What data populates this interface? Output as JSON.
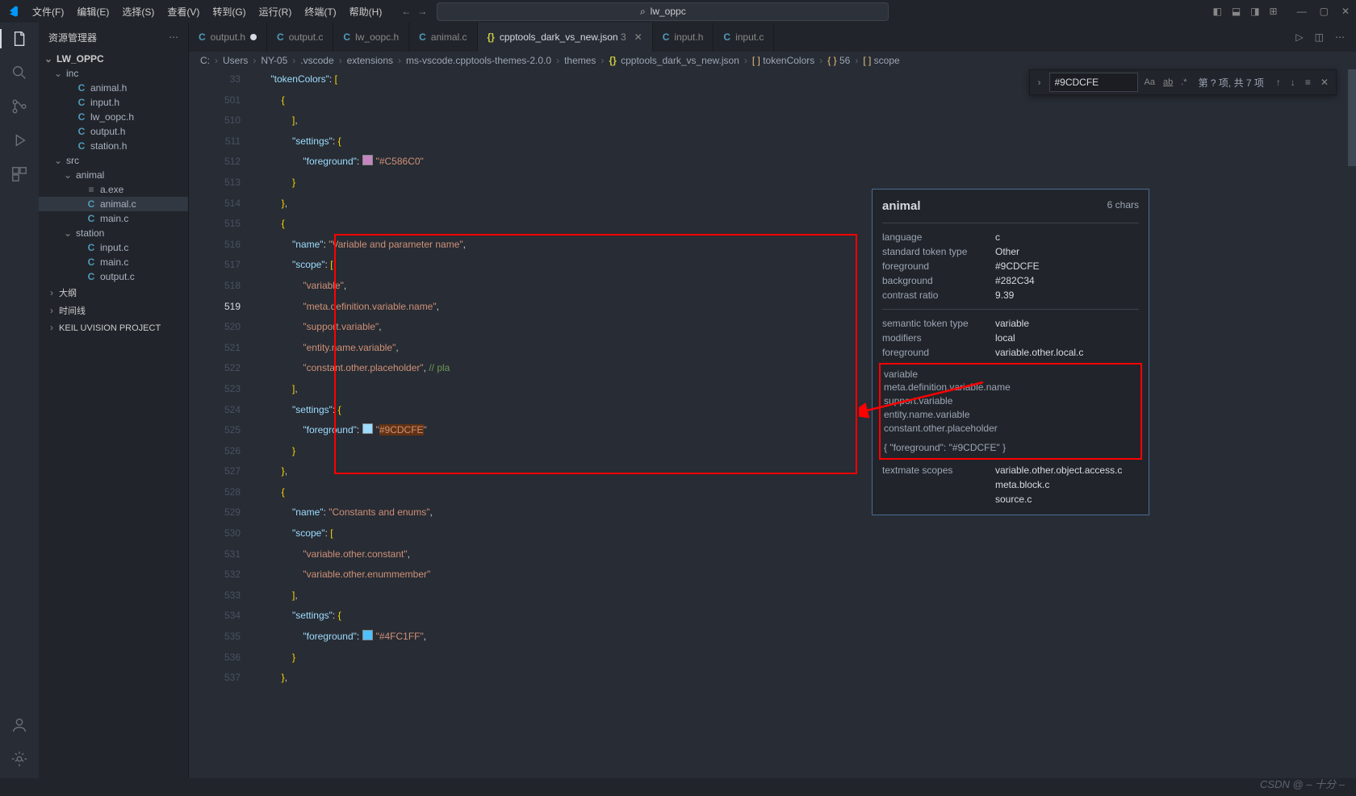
{
  "title": "lw_oppc",
  "menu": [
    "文件(F)",
    "编辑(E)",
    "选择(S)",
    "查看(V)",
    "转到(G)",
    "运行(R)",
    "终端(T)",
    "帮助(H)"
  ],
  "search_placeholder": "lw_oppc",
  "sidebar": {
    "title": "资源管理器",
    "root": "LW_OPPC",
    "inc": {
      "label": "inc",
      "items": [
        "animal.h",
        "input.h",
        "lw_oopc.h",
        "output.h",
        "station.h"
      ]
    },
    "src": {
      "label": "src",
      "animal": {
        "label": "animal",
        "items": [
          "a.exe",
          "animal.c",
          "main.c"
        ]
      },
      "station": {
        "label": "station",
        "items": [
          "input.c",
          "main.c",
          "output.c"
        ]
      }
    },
    "sections": [
      "大纲",
      "时间线",
      "KEIL UVISION PROJECT"
    ]
  },
  "tabs": [
    {
      "icon": "C",
      "label": "output.h",
      "modified": true
    },
    {
      "icon": "C",
      "label": "output.c"
    },
    {
      "icon": "C",
      "label": "lw_oopc.h"
    },
    {
      "icon": "C",
      "label": "animal.c"
    },
    {
      "icon": "{}",
      "label": "cpptools_dark_vs_new.json",
      "suffix": "3",
      "active": true,
      "closeable": true
    },
    {
      "icon": "C",
      "label": "input.h"
    },
    {
      "icon": "C",
      "label": "input.c"
    }
  ],
  "breadcrumb": [
    "C:",
    "Users",
    "NY-05",
    ".vscode",
    "extensions",
    "ms-vscode.cpptools-themes-2.0.0",
    "themes",
    "cpptools_dark_vs_new.json",
    "[ ] tokenColors",
    "{ } 56",
    "[ ] scope"
  ],
  "find": {
    "value": "#9CDCFE",
    "count": "第 ? 项, 共 7 项"
  },
  "code": {
    "lines": [
      {
        "n": "33",
        "txt": [
          [
            "    ",
            ""
          ],
          [
            "\"tokenColors\"",
            "kw"
          ],
          [
            ": ",
            "pun"
          ],
          [
            "[",
            "brk"
          ]
        ]
      },
      {
        "n": "501",
        "txt": [
          [
            "        ",
            ""
          ],
          [
            "{",
            "brk"
          ]
        ]
      },
      {
        "n": "510",
        "txt": [
          [
            "            ",
            ""
          ],
          [
            "]",
            "brk"
          ],
          [
            ",",
            "pun"
          ]
        ]
      },
      {
        "n": "511",
        "txt": [
          [
            "            ",
            ""
          ],
          [
            "\"settings\"",
            "kw"
          ],
          [
            ": ",
            "pun"
          ],
          [
            "{",
            "brk"
          ]
        ]
      },
      {
        "n": "512",
        "txt": [
          [
            "                ",
            ""
          ],
          [
            "\"foreground\"",
            "kw"
          ],
          [
            ": ",
            "pun"
          ],
          [
            "~C586C0",
            ""
          ],
          [
            "\"#C586C0\"",
            "str"
          ]
        ]
      },
      {
        "n": "513",
        "txt": [
          [
            "            ",
            ""
          ],
          [
            "}",
            "brk"
          ]
        ]
      },
      {
        "n": "514",
        "txt": [
          [
            "        ",
            ""
          ],
          [
            "}",
            "brk"
          ],
          [
            ",",
            "pun"
          ]
        ]
      },
      {
        "n": "515",
        "txt": [
          [
            "        ",
            ""
          ],
          [
            "{",
            "brk"
          ]
        ]
      },
      {
        "n": "516",
        "txt": [
          [
            "            ",
            ""
          ],
          [
            "\"name\"",
            "kw"
          ],
          [
            ": ",
            "pun"
          ],
          [
            "\"Variable and parameter name\"",
            "str"
          ],
          [
            ",",
            "pun"
          ]
        ]
      },
      {
        "n": "517",
        "txt": [
          [
            "            ",
            ""
          ],
          [
            "\"scope\"",
            "kw"
          ],
          [
            ": ",
            "pun"
          ],
          [
            "[",
            "brk"
          ]
        ]
      },
      {
        "n": "518",
        "txt": [
          [
            "                ",
            ""
          ],
          [
            "\"variable\"",
            "str"
          ],
          [
            ",",
            "pun"
          ]
        ]
      },
      {
        "n": "519",
        "cur": true,
        "txt": [
          [
            "                ",
            ""
          ],
          [
            "\"meta.definition.variable.name\"",
            "str"
          ],
          [
            ",",
            "pun"
          ]
        ]
      },
      {
        "n": "520",
        "txt": [
          [
            "                ",
            ""
          ],
          [
            "\"support.variable\"",
            "str"
          ],
          [
            ",",
            "pun"
          ]
        ]
      },
      {
        "n": "521",
        "txt": [
          [
            "                ",
            ""
          ],
          [
            "\"entity.name.variable\"",
            "str"
          ],
          [
            ",",
            "pun"
          ]
        ]
      },
      {
        "n": "522",
        "txt": [
          [
            "                ",
            ""
          ],
          [
            "\"constant.other.placeholder\"",
            "str"
          ],
          [
            ", ",
            "pun"
          ],
          [
            "// pla",
            "cmt"
          ]
        ]
      },
      {
        "n": "523",
        "txt": [
          [
            "            ",
            ""
          ],
          [
            "]",
            "brk"
          ],
          [
            ",",
            "pun"
          ]
        ]
      },
      {
        "n": "524",
        "txt": [
          [
            "            ",
            ""
          ],
          [
            "\"settings\"",
            "kw"
          ],
          [
            ": ",
            "pun"
          ],
          [
            "{",
            "brk"
          ]
        ]
      },
      {
        "n": "525",
        "txt": [
          [
            "                ",
            ""
          ],
          [
            "\"foreground\"",
            "kw"
          ],
          [
            ": ",
            "pun"
          ],
          [
            "~9CDCFE",
            ""
          ],
          [
            "\"",
            "str"
          ],
          [
            "#9CDCFE",
            "str hl"
          ],
          [
            "\"",
            "str"
          ]
        ]
      },
      {
        "n": "526",
        "txt": [
          [
            "            ",
            ""
          ],
          [
            "}",
            "brk"
          ]
        ]
      },
      {
        "n": "527",
        "txt": [
          [
            "        ",
            ""
          ],
          [
            "}",
            "brk"
          ],
          [
            ",",
            "pun"
          ]
        ]
      },
      {
        "n": "528",
        "txt": [
          [
            "        ",
            ""
          ],
          [
            "{",
            "brk"
          ]
        ]
      },
      {
        "n": "529",
        "txt": [
          [
            "            ",
            ""
          ],
          [
            "\"name\"",
            "kw"
          ],
          [
            ": ",
            "pun"
          ],
          [
            "\"Constants and enums\"",
            "str"
          ],
          [
            ",",
            "pun"
          ]
        ]
      },
      {
        "n": "530",
        "txt": [
          [
            "            ",
            ""
          ],
          [
            "\"scope\"",
            "kw"
          ],
          [
            ": ",
            "pun"
          ],
          [
            "[",
            "brk"
          ]
        ]
      },
      {
        "n": "531",
        "txt": [
          [
            "                ",
            ""
          ],
          [
            "\"variable.other.constant\"",
            "str"
          ],
          [
            ",",
            "pun"
          ]
        ]
      },
      {
        "n": "532",
        "txt": [
          [
            "                ",
            ""
          ],
          [
            "\"variable.other.enummember\"",
            "str"
          ]
        ]
      },
      {
        "n": "533",
        "txt": [
          [
            "            ",
            ""
          ],
          [
            "]",
            "brk"
          ],
          [
            ",",
            "pun"
          ]
        ]
      },
      {
        "n": "534",
        "txt": [
          [
            "            ",
            ""
          ],
          [
            "\"settings\"",
            "kw"
          ],
          [
            ": ",
            "pun"
          ],
          [
            "{",
            "brk"
          ]
        ]
      },
      {
        "n": "535",
        "txt": [
          [
            "                ",
            ""
          ],
          [
            "\"foreground\"",
            "kw"
          ],
          [
            ": ",
            "pun"
          ],
          [
            "~4FC1FF",
            ""
          ],
          [
            "\"#4FC1FF\"",
            "str"
          ],
          [
            ",",
            "pun"
          ]
        ]
      },
      {
        "n": "536",
        "txt": [
          [
            "            ",
            ""
          ],
          [
            "}",
            "brk"
          ]
        ]
      },
      {
        "n": "537",
        "txt": [
          [
            "        ",
            ""
          ],
          [
            "}",
            "brk"
          ],
          [
            ",",
            "pun"
          ]
        ]
      }
    ]
  },
  "hover": {
    "title": "animal",
    "chars": "6 chars",
    "rows1": [
      [
        "language",
        "c"
      ],
      [
        "standard token type",
        "Other"
      ],
      [
        "foreground",
        "#9CDCFE"
      ],
      [
        "background",
        "#282C34"
      ],
      [
        "contrast ratio",
        "9.39"
      ]
    ],
    "rows2": [
      [
        "semantic token type",
        "variable"
      ],
      [
        "modifiers",
        "local"
      ],
      [
        "foreground",
        "variable.other.local.c"
      ]
    ],
    "scopes": [
      "variable",
      "meta.definition.variable.name",
      "support.variable",
      "entity.name.variable",
      "constant.other.placeholder"
    ],
    "scopeRule": "{ \"foreground\": \"#9CDCFE\" }",
    "rows3": [
      [
        "textmate scopes",
        "variable.other.object.access.c"
      ],
      [
        "",
        "meta.block.c"
      ],
      [
        "",
        "source.c"
      ]
    ]
  },
  "watermark": "CSDN @ – 十分 –"
}
